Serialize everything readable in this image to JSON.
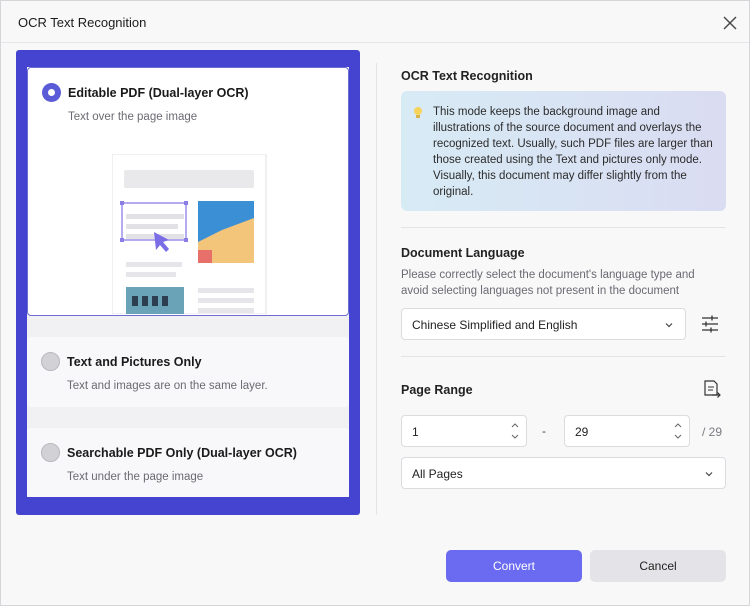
{
  "window": {
    "title": "OCR Text Recognition"
  },
  "modes": [
    {
      "title": "Editable PDF (Dual-layer OCR)",
      "subtitle": "Text over the page image",
      "selected": true
    },
    {
      "title": "Text and Pictures Only",
      "subtitle": "Text and images are on the same layer.",
      "selected": false
    },
    {
      "title": "Searchable PDF Only (Dual-layer OCR)",
      "subtitle": "Text under the page image",
      "selected": false
    }
  ],
  "right": {
    "section_title": "OCR Text Recognition",
    "info_text": "This mode keeps the background image and illustrations of the source document and overlays the recognized text. Usually, such PDF files are larger than those created using the Text and pictures only mode. Visually, this document may differ slightly from the original.",
    "language": {
      "title": "Document Language",
      "description": "Please correctly select the document's language type and avoid selecting languages not present in the document",
      "selected": "Chinese Simplified and English"
    },
    "page_range": {
      "title": "Page Range",
      "from": "1",
      "separator": "-",
      "to": "29",
      "total": "/ 29",
      "scope": "All Pages"
    }
  },
  "buttons": {
    "convert": "Convert",
    "cancel": "Cancel"
  },
  "colors": {
    "accent": "#6b6bf2",
    "frame": "#4444d0",
    "selected_radio": "#5b5bd8"
  },
  "icons": [
    "close-icon",
    "lightbulb-icon",
    "chevron-down-icon",
    "settings-sliders-icon",
    "page-range-icon",
    "spin-arrows-icon"
  ]
}
